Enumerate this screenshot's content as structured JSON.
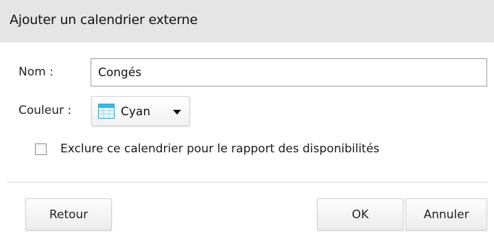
{
  "dialog": {
    "title": "Ajouter un calendrier externe"
  },
  "form": {
    "name_label": "Nom :",
    "name_value": "Congés",
    "color_label": "Couleur :",
    "color_value": "Cyan",
    "color_icon": "calendar-icon",
    "color_accent": "#3bb8e6",
    "exclude_label": "Exclure ce calendrier pour le rapport des disponibilités",
    "exclude_checked": false
  },
  "buttons": {
    "back_label": "Retour",
    "ok_label": "OK",
    "cancel_label": "Annuler"
  },
  "colors": {
    "title_bar_bg": "#e5e5e5",
    "divider": "#d4d4d4"
  }
}
